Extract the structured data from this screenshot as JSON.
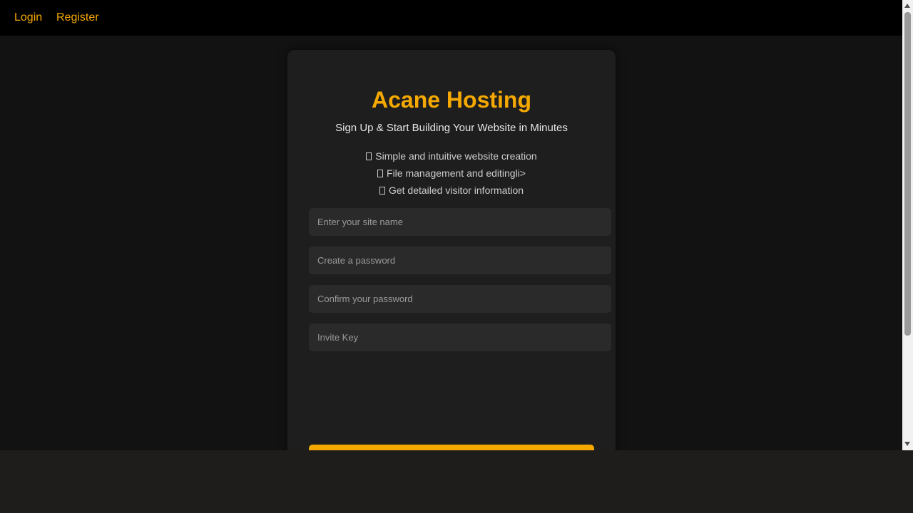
{
  "nav": {
    "login_label": "Login",
    "register_label": "Register"
  },
  "card": {
    "title": "Acane Hosting",
    "tagline": "Sign Up & Start Building Your Website in Minutes",
    "features": [
      {
        "icon": "missing-glyph-icon",
        "text": "Simple and intuitive website creation"
      },
      {
        "icon": "missing-glyph-icon",
        "text": "File management and editingli>"
      },
      {
        "icon": "missing-glyph-icon",
        "text": "Get detailed visitor information"
      }
    ],
    "form": {
      "site_name_placeholder": "Enter your site name",
      "password_placeholder": "Create a password",
      "confirm_password_placeholder": "Confirm your password",
      "invite_key_placeholder": "Invite Key"
    }
  },
  "colors": {
    "accent": "#f5a800",
    "page_background": "#121212",
    "card_background": "#1e1e1e",
    "input_background": "#2a2a2a",
    "navbar_background": "#000000"
  }
}
